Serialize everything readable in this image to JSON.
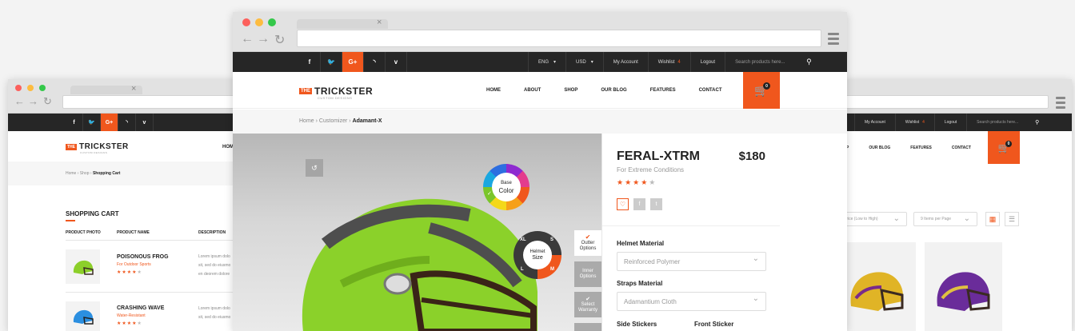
{
  "tabs_close": "×",
  "social": [
    "f",
    "t",
    "G+",
    "rss",
    "v"
  ],
  "topbar": {
    "lang": "ENG",
    "currency": "USD",
    "account": "My Account",
    "wishlist": "Wishlist",
    "wishlist_count": "4",
    "logout": "Logout",
    "search_placeholder": "Search products here..."
  },
  "logo": {
    "the": "THE",
    "name": "TRICKSTER",
    "sub": "CUSTOM DESIGNS"
  },
  "menu": {
    "home": "HOME",
    "about": "ABOUT",
    "shop": "SHOP",
    "blog": "OUR BLOG",
    "features": "FEATURES",
    "contact": "CONTACT"
  },
  "menu_short": {
    "home": "HOM",
    "shop": "P",
    "blog": "OUR BLOG",
    "features": "FEATURES",
    "contact": "CONTACT"
  },
  "cart_count": "0",
  "front": {
    "breadcrumb": {
      "home": "Home",
      "mid": "Customizer",
      "current": "Adamant-X"
    },
    "product": {
      "name": "FERAL-XTRM",
      "price": "$180",
      "subtitle": "For Extreme Conditions",
      "rating": 4
    },
    "base_color": {
      "line1": "Base",
      "line2": "Color"
    },
    "size": {
      "title1": "Helmet",
      "title2": "Size",
      "xl": "XL",
      "s": "S",
      "l": "L",
      "m": "M"
    },
    "options": [
      {
        "l1": "Outter",
        "l2": "Options"
      },
      {
        "l1": "Inner",
        "l2": "Options"
      },
      {
        "l1": "Select",
        "l2": "Warranty"
      }
    ],
    "helmet_material": {
      "label": "Helmet Material",
      "value": "Reinforced Polymer"
    },
    "straps_material": {
      "label": "Straps Material",
      "value": "Adamantium Cloth"
    },
    "side_stickers": "Side Stickers",
    "front_sticker": "Front Sticker"
  },
  "left": {
    "breadcrumb": {
      "home": "Home",
      "mid": "Shop",
      "current": "Shopping Cart"
    },
    "title": "SHOPPING CART",
    "columns": [
      "PRODUCT PHOTO",
      "PRODUCT NAME",
      "DESCRIPTION"
    ],
    "items": [
      {
        "name": "POISONOUS FROG",
        "sub": "For Outdoor Sports",
        "desc": [
          "Lorem ipsum dolo",
          "sit, sed do eiusmo",
          "en deorem dolore"
        ],
        "rating": 4
      },
      {
        "name": "CRASHING WAVE",
        "sub": "Water-Resistant",
        "desc": [
          "Lorem ipsum dolo",
          "sit, sed do eiusmo"
        ],
        "rating": 4
      }
    ]
  },
  "right": {
    "sort": "Price (Low to High)",
    "per_page": "9 Items per Page"
  },
  "colors": {
    "accent": "#f0571d",
    "dark": "#262626"
  }
}
